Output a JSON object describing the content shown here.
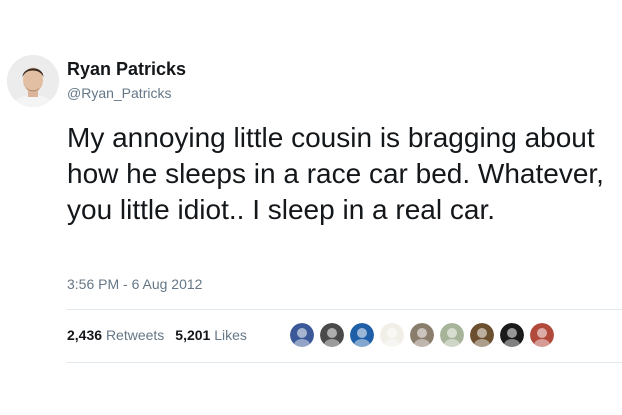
{
  "author": {
    "name": "Ryan Patricks",
    "handle": "@Ryan_Patricks",
    "avatar_icon": "user-avatar"
  },
  "tweet": {
    "text": "My annoying little cousin is bragging about how he sleeps in a race car bed. Whatever, you little idiot.. I sleep in a real car.",
    "timestamp": "3:56 PM - 6 Aug 2012"
  },
  "stats": {
    "retweets_count": "2,436",
    "retweets_label": "Retweets",
    "likes_count": "5,201",
    "likes_label": "Likes"
  },
  "likers": [
    {
      "icon": "liker-avatar",
      "color": "#3b5998"
    },
    {
      "icon": "liker-avatar",
      "color": "#4a4a4a"
    },
    {
      "icon": "liker-avatar",
      "color": "#1f5fa8"
    },
    {
      "icon": "liker-avatar",
      "color": "#f2efe8"
    },
    {
      "icon": "liker-avatar",
      "color": "#8a7d6b"
    },
    {
      "icon": "liker-avatar",
      "color": "#a7b49a"
    },
    {
      "icon": "liker-avatar",
      "color": "#6b4f2e"
    },
    {
      "icon": "liker-avatar",
      "color": "#1a1a1a"
    },
    {
      "icon": "liker-avatar",
      "color": "#b24a3c"
    }
  ],
  "colors": {
    "text_primary": "#14171a",
    "text_secondary": "#657786",
    "divider": "#e1e8ed"
  }
}
